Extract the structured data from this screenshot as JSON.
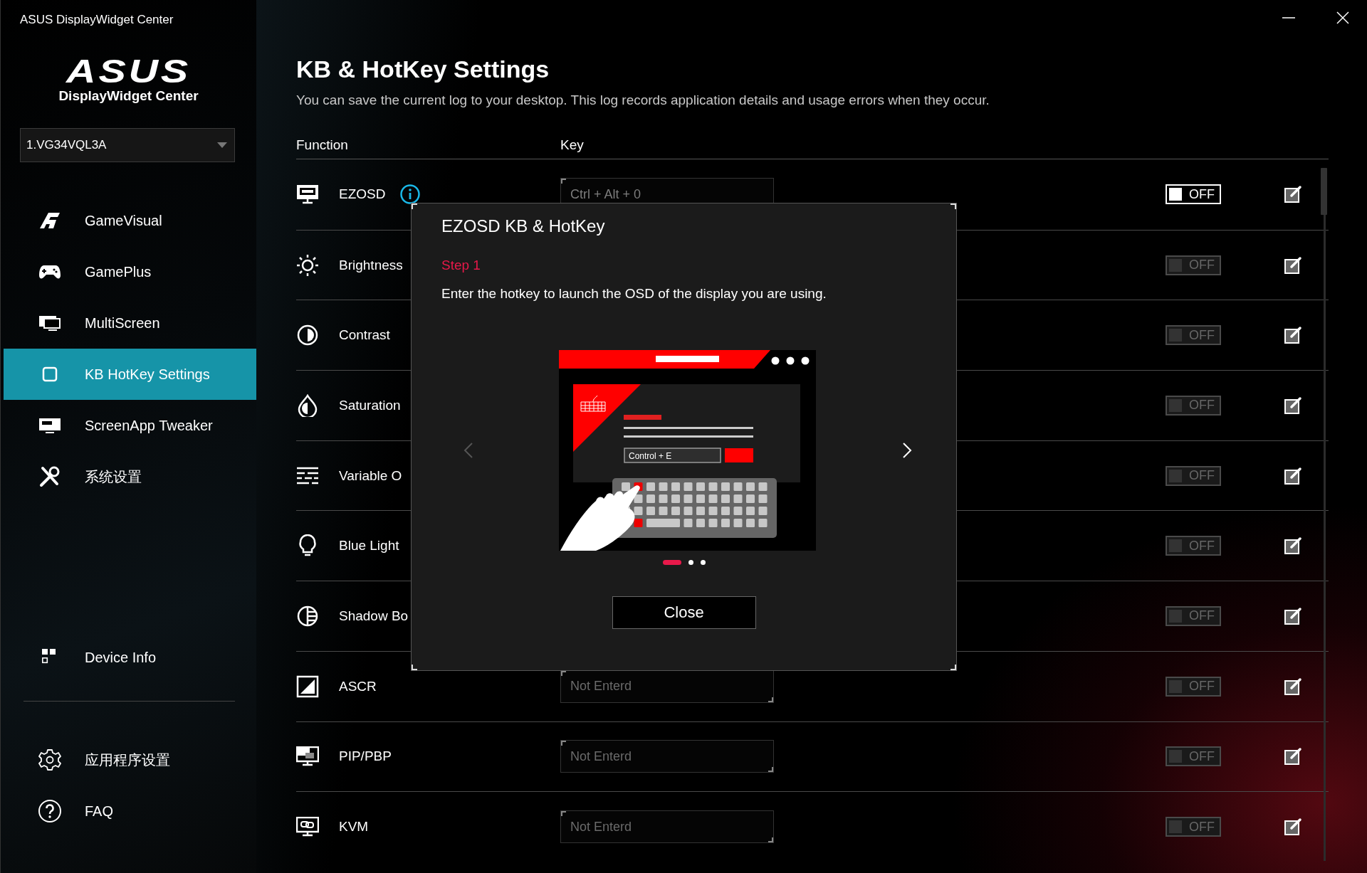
{
  "window": {
    "title": "ASUS DisplayWidget Center"
  },
  "sidebar": {
    "logo": "ASUS",
    "product": "DisplayWidget Center",
    "monitor_select": {
      "value": "1.VG34VQL3A"
    },
    "nav": [
      {
        "label": "GameVisual",
        "selected": false
      },
      {
        "label": "GamePlus",
        "selected": false
      },
      {
        "label": "MultiScreen",
        "selected": false
      },
      {
        "label": "KB HotKey Settings",
        "selected": true
      },
      {
        "label": "ScreenApp Tweaker",
        "selected": false
      },
      {
        "label": "系统设置",
        "selected": false
      }
    ],
    "device_info": {
      "label": "Device Info",
      "selected": false
    },
    "bottom": [
      {
        "label": "应用程序设置",
        "selected": false
      },
      {
        "label": "FAQ",
        "selected": false
      }
    ]
  },
  "page": {
    "title": "KB & HotKey Settings",
    "description": "You can save the current log to your desktop. This log records application details and usage errors when they occur.",
    "columns": [
      "Function",
      "Key"
    ],
    "rows": [
      {
        "function": "EZOSD",
        "info_icon": true,
        "key_value": "Ctrl + Alt + 0",
        "toggle": {
          "label": "OFF",
          "disabled": false
        }
      },
      {
        "function": "Brightness",
        "toggle": {
          "label": "OFF",
          "disabled": true
        }
      },
      {
        "function": "Contrast",
        "toggle": {
          "label": "OFF",
          "disabled": true
        }
      },
      {
        "function": "Saturation",
        "toggle": {
          "label": "OFF",
          "disabled": true
        }
      },
      {
        "function": "Variable O",
        "toggle": {
          "label": "OFF",
          "disabled": true
        }
      },
      {
        "function": "Blue Light",
        "toggle": {
          "label": "OFF",
          "disabled": true
        }
      },
      {
        "function": "Shadow Bo",
        "toggle": {
          "label": "OFF",
          "disabled": true
        }
      },
      {
        "function": "ASCR",
        "key_placeholder": "Not Enterd",
        "toggle": {
          "label": "OFF",
          "disabled": true
        }
      },
      {
        "function": "PIP/PBP",
        "key_placeholder": "Not Enterd",
        "toggle": {
          "label": "OFF",
          "disabled": true
        }
      },
      {
        "function": "KVM",
        "key_placeholder": "Not Enterd",
        "toggle": {
          "label": "OFF",
          "disabled": true
        }
      }
    ]
  },
  "dialog": {
    "title": "EZOSD KB & HotKey",
    "step": "Step 1",
    "text": "Enter the hotkey to launch the OSD of the display you are using.",
    "illustration_field": "Control + E",
    "prev": {
      "disabled": true
    },
    "next": {
      "disabled": false
    },
    "pages": [
      {
        "selected": true
      },
      {
        "selected": false
      },
      {
        "selected": false
      }
    ],
    "close": "Close"
  }
}
